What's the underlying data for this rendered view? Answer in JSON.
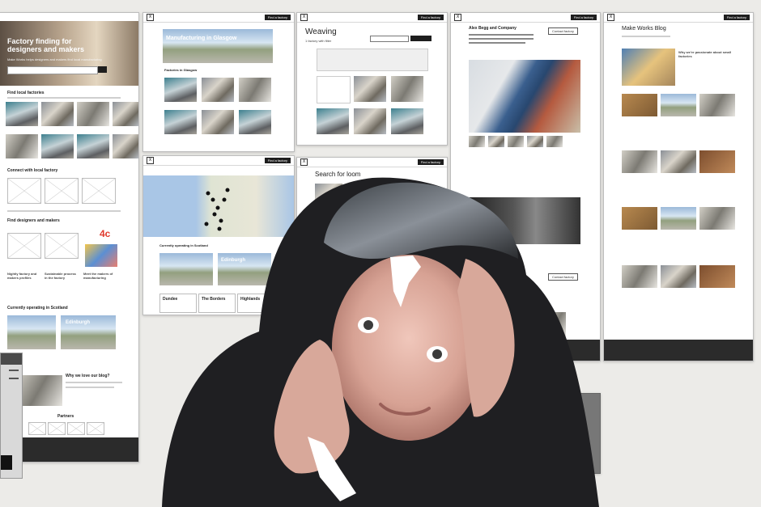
{
  "site": {
    "close_label": "X",
    "nav_button": "Find a factory"
  },
  "boards": {
    "home": {
      "hero_title": "Factory finding for designers and makers",
      "hero_sub": "Make Works helps designers and makers find local manufacturing",
      "section_find": "Find local factories",
      "section_connect": "Connect with local factory",
      "section_find_makers": "Find designers and makers",
      "section_coverage": "Currently operating in Scotland",
      "card_labels": [
        "Edinburgh"
      ],
      "feature_titles": [
        "Nightly factory and makers profiles",
        "Sustainable process in the factory",
        "Meet the makers of manufacturing"
      ],
      "badge": "4c",
      "blog_title": "Why we love our blog?",
      "partners_label": "Partners"
    },
    "glasgow": {
      "hero_title": "Manufacturing in Glasgow",
      "section_title": "Factories in Glasgow"
    },
    "map": {
      "coverage_title": "Currently operating in Scotland",
      "cards": [
        "Edinburgh",
        "Dundee",
        "The Borders",
        "Highlands"
      ]
    },
    "weaving": {
      "title": "Weaving",
      "subtitle": "1 factory with filter"
    },
    "sourcing": {
      "title": "Search for loom"
    },
    "company": {
      "title": "Alex Begg and Company",
      "button": "Contact factory"
    },
    "blog": {
      "title": "Make Works Blog",
      "item_title": "Why we're passionate about small factories"
    }
  },
  "photo_labels": {
    "glasgow_hero": "Manufacturing in Glasgow"
  }
}
